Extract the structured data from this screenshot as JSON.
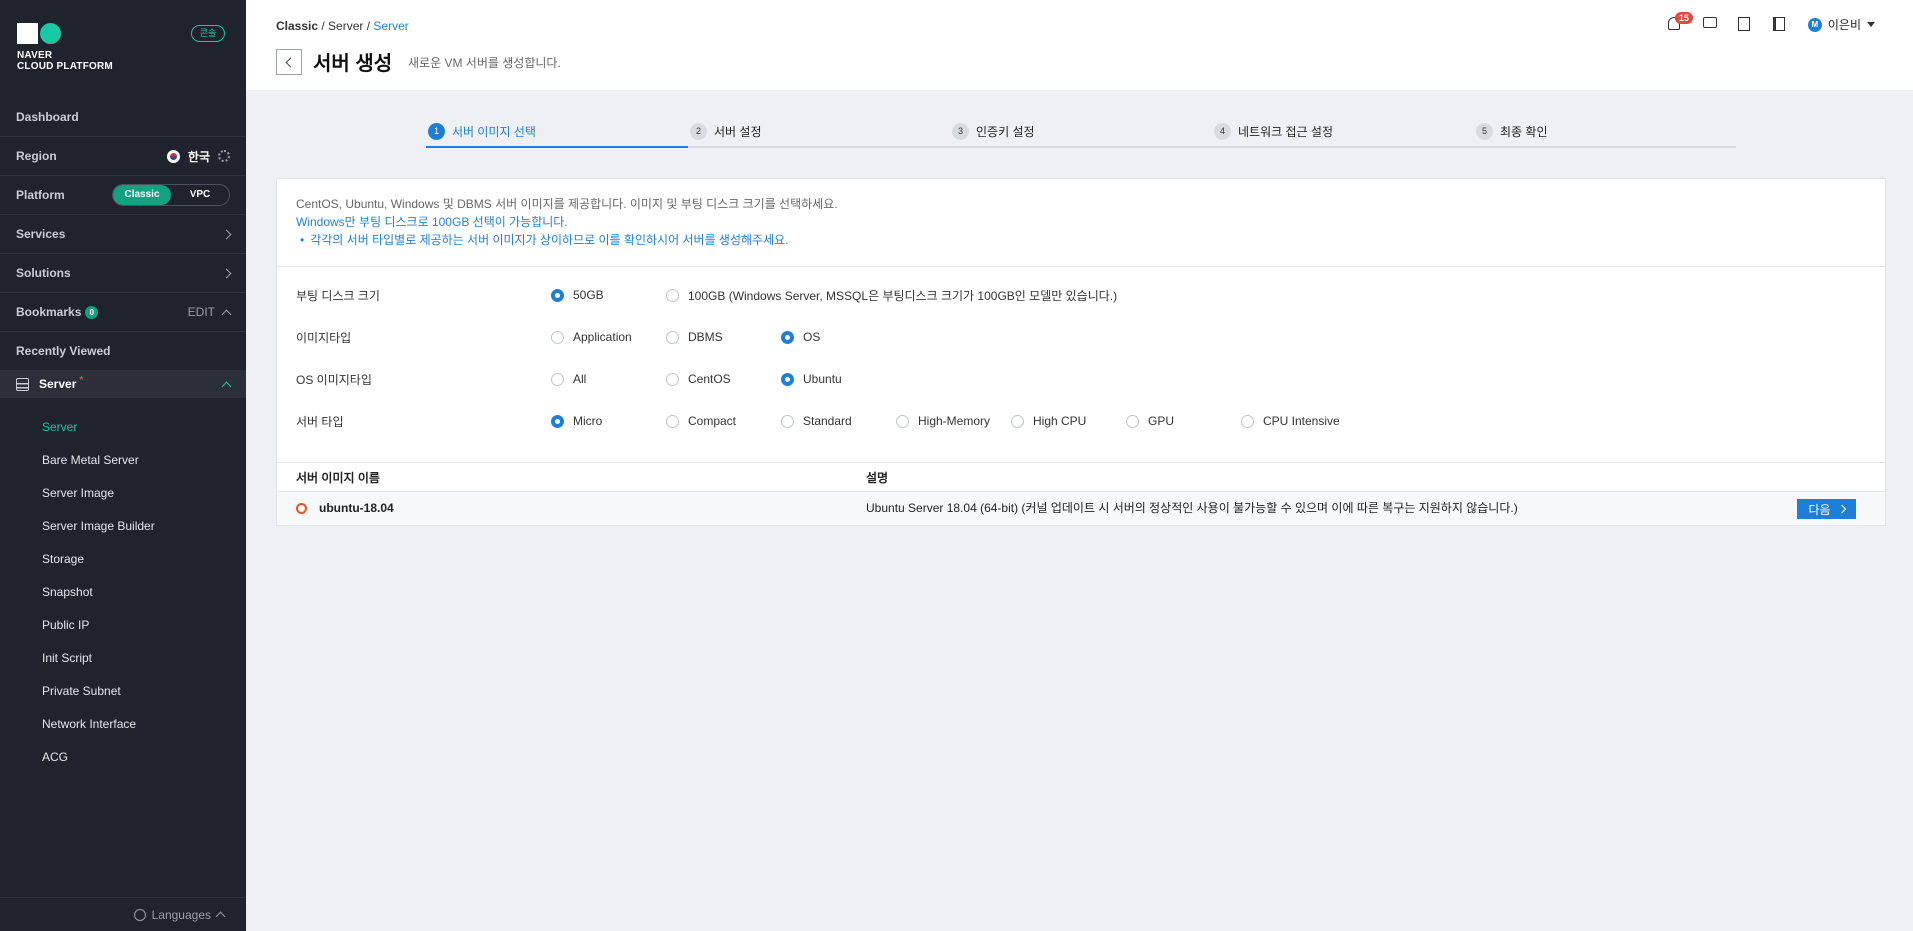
{
  "sidebar": {
    "logo_line1": "NAVER",
    "logo_line2": "CLOUD PLATFORM",
    "console_badge": "콘솔",
    "dashboard": "Dashboard",
    "region_label": "Region",
    "region_value": "한국",
    "platform_label": "Platform",
    "platform_options": [
      "Classic",
      "VPC"
    ],
    "platform_selected": "Classic",
    "services": "Services",
    "solutions": "Solutions",
    "bookmarks": "Bookmarks",
    "bookmarks_count": "0",
    "bookmarks_edit": "EDIT",
    "recently_viewed": "Recently Viewed",
    "server_group": "Server",
    "server_group_mark": "*",
    "sub_items": [
      "Server",
      "Bare Metal Server",
      "Server Image",
      "Server Image Builder",
      "Storage",
      "Snapshot",
      "Public IP",
      "Init Script",
      "Private Subnet",
      "Network Interface",
      "ACG"
    ],
    "active_sub_item": "Server",
    "languages": "Languages"
  },
  "header": {
    "breadcrumb": [
      "Classic",
      "Server",
      "Server"
    ],
    "title": "서버 생성",
    "subtitle": "새로운 VM 서버를 생성합니다.",
    "notification_count": "15",
    "user_initial": "M",
    "user_name": "이은비"
  },
  "steps": [
    {
      "num": "1",
      "label": "서버 이미지 선택",
      "active": true
    },
    {
      "num": "2",
      "label": "서버 설정",
      "active": false
    },
    {
      "num": "3",
      "label": "인증키 설정",
      "active": false
    },
    {
      "num": "4",
      "label": "네트워크 접근 설정",
      "active": false
    },
    {
      "num": "5",
      "label": "최종 확인",
      "active": false
    }
  ],
  "info": {
    "line1": "CentOS, Ubuntu, Windows 및 DBMS 서버 이미지를 제공합니다. 이미지 및 부팅 디스크 크기를 선택하세요.",
    "line2": "Windows만 부팅 디스크로 100GB 선택이 가능합니다.",
    "line3": "각각의 서버 타입별로 제공하는 서버 이미지가 상이하므로 이를 확인하시어 서버를 생성해주세요."
  },
  "form": {
    "boot_disk": {
      "label": "부팅 디스크 크기",
      "options": [
        "50GB",
        "100GB (Windows Server, MSSQL은 부팅디스크 크기가 100GB인 모델만 있습니다.)"
      ],
      "selected": "50GB"
    },
    "image_type": {
      "label": "이미지타입",
      "options": [
        "Application",
        "DBMS",
        "OS"
      ],
      "selected": "OS"
    },
    "os_image_type": {
      "label": "OS 이미지타입",
      "options": [
        "All",
        "CentOS",
        "Ubuntu"
      ],
      "selected": "Ubuntu"
    },
    "server_type": {
      "label": "서버 타입",
      "options": [
        "Micro",
        "Compact",
        "Standard",
        "High-Memory",
        "High CPU",
        "GPU",
        "CPU Intensive"
      ],
      "selected": "Micro"
    }
  },
  "table": {
    "headers": [
      "서버 이미지 이름",
      "설명"
    ],
    "rows": [
      {
        "name": "ubuntu-18.04",
        "description": "Ubuntu Server 18.04 (64-bit) (커널 업데이트 시 서버의 정상적인 사용이 불가능할 수 있으며 이에 따른 복구는 지원하지 않습니다.)",
        "action": "다음"
      }
    ]
  },
  "colors": {
    "accent": "#1f7fd8",
    "brand": "#19c8a5",
    "sidebar_bg": "#1f232d"
  }
}
